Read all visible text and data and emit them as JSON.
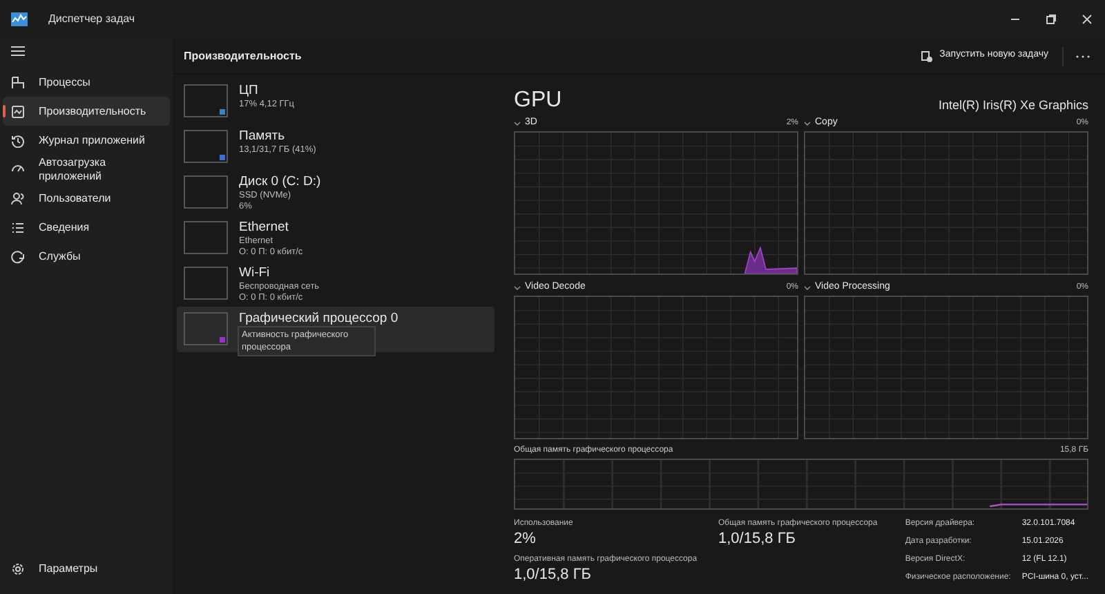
{
  "window": {
    "title": "Диспетчер задач"
  },
  "sidebar": {
    "items": [
      {
        "label": "Процессы",
        "selected": false
      },
      {
        "label": "Производительность",
        "selected": true
      },
      {
        "label": "Журнал приложений",
        "selected": false
      },
      {
        "label": "Автозагрузка приложений",
        "selected": false
      },
      {
        "label": "Пользователи",
        "selected": false
      },
      {
        "label": "Сведения",
        "selected": false
      },
      {
        "label": "Службы",
        "selected": false
      }
    ],
    "footer": {
      "label": "Параметры"
    }
  },
  "header": {
    "title": "Производительность",
    "run_task_button": "Запустить новую задачу"
  },
  "devices": [
    {
      "name": "ЦП",
      "lines": [
        "17% 4,12 ГГц"
      ],
      "selected": false,
      "color": "#3b82c4"
    },
    {
      "name": "Память",
      "lines": [
        "13,1/31,7 ГБ (41%)"
      ],
      "selected": false,
      "color": "#3b6fd4"
    },
    {
      "name": "Диск 0 (C: D:)",
      "lines": [
        "SSD (NVMe)",
        "6%"
      ],
      "selected": false
    },
    {
      "name": "Ethernet",
      "lines": [
        "Ethernet",
        "О: 0 П: 0 кбит/с"
      ],
      "selected": false
    },
    {
      "name": "Wi-Fi",
      "lines": [
        "Беспроводная сеть",
        "О: 0 П: 0 кбит/с"
      ],
      "selected": false
    },
    {
      "name": "Графический процессор 0",
      "selected": true,
      "color": "#9b30c8"
    }
  ],
  "tooltip": {
    "text": "Активность графического процессора"
  },
  "gpu": {
    "title": "GPU",
    "adapter": "Intel(R) Iris(R) Xe Graphics",
    "engines": [
      {
        "name": "3D",
        "reading": "2%"
      },
      {
        "name": "Copy",
        "reading": "0%"
      },
      {
        "name": "Video Decode",
        "reading": "0%"
      },
      {
        "name": "Video Processing",
        "reading": "0%"
      }
    ],
    "shared_memory_graph": {
      "label": "Общая память графического процессора",
      "reading": "15,8 ГБ"
    },
    "stats": [
      {
        "label": "Использование",
        "value": "2%"
      },
      {
        "label": "Общая память графического процессора",
        "value": "1,0/15,8 ГБ"
      },
      {
        "label": "Оперативная память графического процессора",
        "value": "1,0/15,8 ГБ"
      }
    ],
    "details": [
      {
        "label": "Версия драйвера:",
        "value": "32.0.101.7084"
      },
      {
        "label": "Дата разработки:",
        "value": "15.01.2026"
      },
      {
        "label": "Версия DirectX:",
        "value": "12 (FL 12.1)"
      },
      {
        "label": "Физическое расположение:",
        "value": "PCI-шина 0, уст..."
      }
    ]
  }
}
